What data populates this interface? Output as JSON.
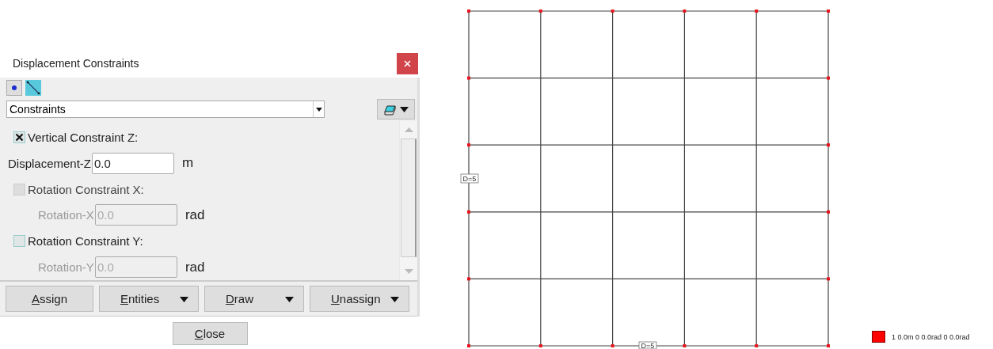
{
  "dialog": {
    "title": "Displacement Constraints",
    "entity_tools": [
      {
        "kind": "point",
        "selected": false
      },
      {
        "kind": "line",
        "selected": true
      }
    ],
    "set_dropdown": {
      "value": "Constraints"
    },
    "rows": [
      {
        "kind": "check",
        "label": "Vertical Constraint Z:",
        "checked": true,
        "disabled": false
      },
      {
        "kind": "field",
        "label": "Displacement-Z",
        "value": "0.0",
        "unit": "m",
        "disabled": false
      },
      {
        "kind": "check",
        "label": "Rotation Constraint X:",
        "checked": false,
        "disabled": true
      },
      {
        "kind": "field",
        "label": "Rotation-X",
        "value": "0.0",
        "unit": "rad",
        "disabled": true
      },
      {
        "kind": "check",
        "label": "Rotation Constraint Y:",
        "checked": false,
        "disabled": false
      },
      {
        "kind": "field",
        "label": "Rotation-Y",
        "value": "0.0",
        "unit": "rad",
        "disabled": true
      }
    ],
    "actions": [
      {
        "label": "Assign",
        "menu": false
      },
      {
        "label": "Entities",
        "menu": true
      },
      {
        "label": "Draw",
        "menu": true
      },
      {
        "label": "Unassign",
        "menu": true
      }
    ],
    "close_button": {
      "label": "Close"
    }
  },
  "view": {
    "dimension_labels": [
      "D=5",
      "D=5"
    ]
  },
  "legend": [
    {
      "color": "#ff0000",
      "text": "1 0.0m 0 0.0rad 0 0.0rad"
    }
  ]
}
